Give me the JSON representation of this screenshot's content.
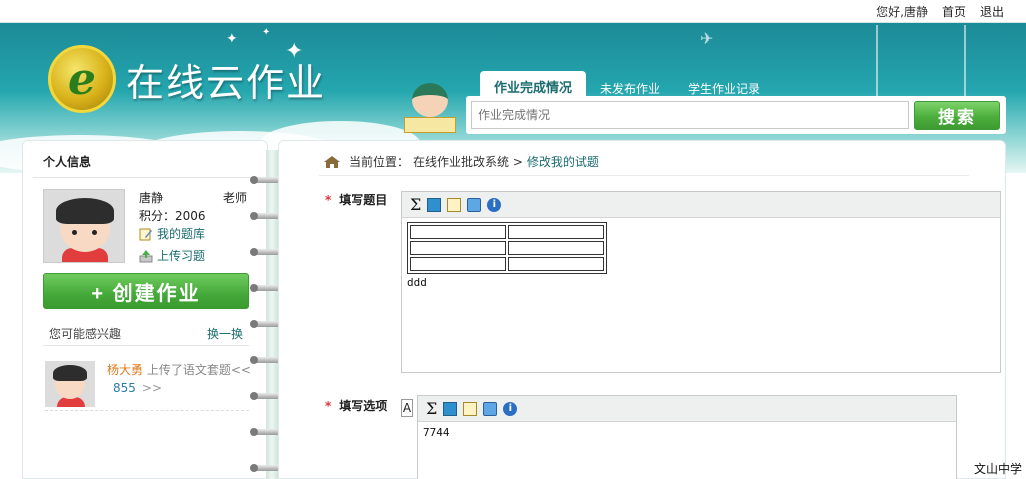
{
  "topbar": {
    "greeting": "您好,唐静",
    "home_label": "首页",
    "logout_label": "退出"
  },
  "header": {
    "logo_letter": "e",
    "app_title": "在线云作业",
    "tabs": [
      {
        "label": "作业完成情况",
        "active": true
      },
      {
        "label": "未发布作业",
        "active": false
      },
      {
        "label": "学生作业记录",
        "active": false
      }
    ],
    "search": {
      "placeholder": "作业完成情况",
      "button_label": "搜索"
    }
  },
  "sidebar": {
    "title": "个人信息",
    "user": {
      "name": "唐静",
      "role": "老师",
      "score_text": "积分：2006"
    },
    "links": [
      {
        "label": "我的题库",
        "icon": "question-bank-icon"
      },
      {
        "label": "上传习题",
        "icon": "upload-icon"
      }
    ],
    "create_button": "+ 创建作业",
    "interest_label": "您可能感兴趣",
    "refresh_label": "换一换",
    "feed": {
      "name": "杨大勇",
      "action": "上传了语文套题<<",
      "count": "855",
      "more": ">>"
    }
  },
  "main": {
    "breadcrumb": {
      "prefix": "当前位置：",
      "path": "在线作业批改系统 >",
      "current": "修改我的试题"
    },
    "question_field": {
      "required_mark": "*",
      "label": "填写题目",
      "toolbar_sigma": "Σ",
      "content_text": "ddd"
    },
    "option_field": {
      "required_mark": "*",
      "label": "填写选项",
      "letter": "A",
      "toolbar_sigma": "Σ",
      "content_text": "7744"
    }
  },
  "footer": {
    "school": "文山中学"
  },
  "colors": {
    "header_teal": "#24a6ae",
    "accent_green": "#45a93a",
    "link_teal": "#1a6c70",
    "required_red": "#d33"
  }
}
